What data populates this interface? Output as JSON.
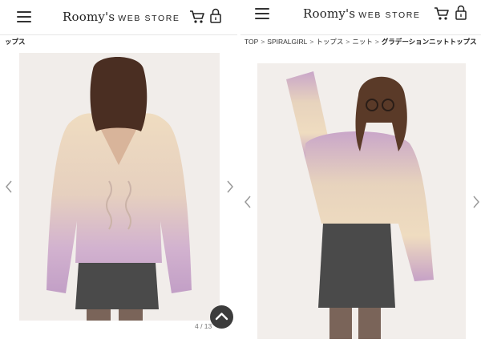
{
  "left": {
    "brand": {
      "main": "Roomy's",
      "sub": "WEB STORE"
    },
    "clipped_breadcrumb_tail": "ップス",
    "photo_alt": "Back view of model wearing a gradation knit sweater",
    "slide_counter": "4 / 13"
  },
  "right": {
    "brand": {
      "main": "Roomy's",
      "sub": "WEB STORE"
    },
    "breadcrumb": [
      {
        "label": "TOP"
      },
      {
        "label": "SPIRALGIRL"
      },
      {
        "label": "トップス"
      },
      {
        "label": "ニット"
      }
    ],
    "breadcrumb_current": "グラデーションニットトップス",
    "breadcrumb_separator": ">",
    "photo_alt": "Front view of model wearing a gradation knit sweater"
  },
  "colors": {
    "sweater_top": "#efdcc0",
    "sweater_bottom": "#c9a6c9",
    "skirt": "#4a4a4a",
    "header_border": "#e6e6e6"
  }
}
